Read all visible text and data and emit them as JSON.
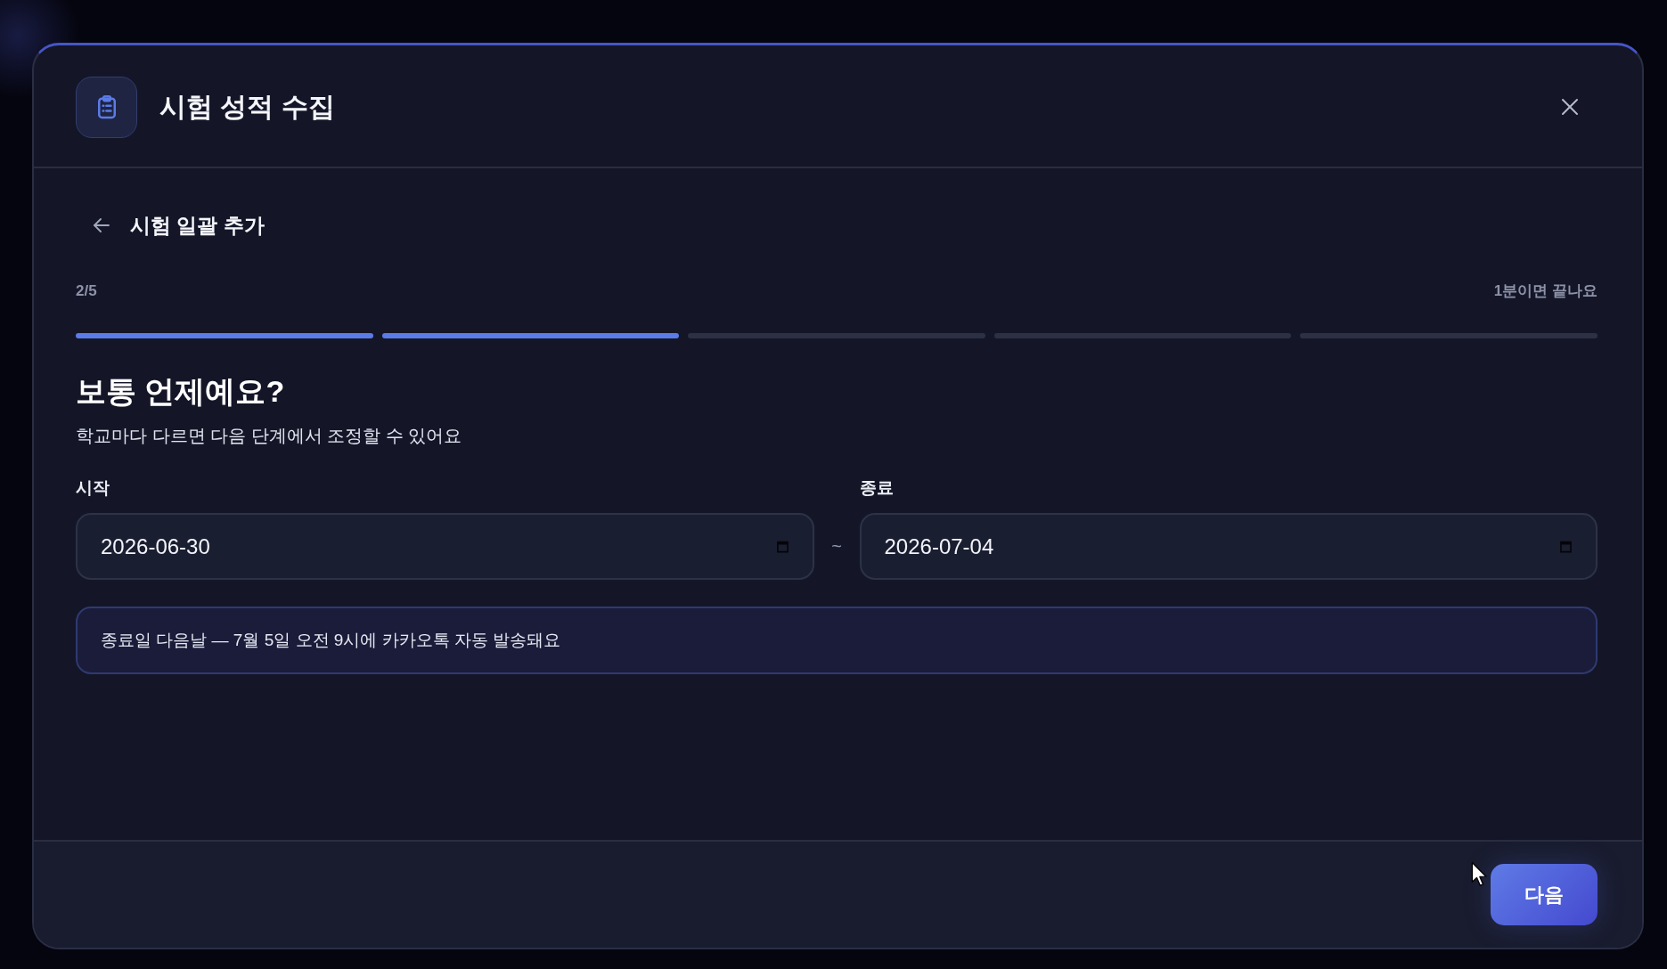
{
  "dialog": {
    "title": "시험 성적 수집"
  },
  "step_header": {
    "title": "시험 일괄 추가"
  },
  "progress": {
    "step": "2/5",
    "hint": "1분이면 끝나요",
    "segments": [
      {
        "filled": true
      },
      {
        "filled": true
      },
      {
        "filled": false
      },
      {
        "filled": false
      },
      {
        "filled": false
      }
    ]
  },
  "question": {
    "heading": "보통 언제예요?",
    "description": "학교마다 다르면 다음 단계에서 조정할 수 있어요"
  },
  "date_range": {
    "start": {
      "label": "시작",
      "value": "2026-06-30"
    },
    "separator": "~",
    "end": {
      "label": "종료",
      "value": "2026-07-04"
    }
  },
  "notice": "종료일 다음날 — 7월 5일 오전 9시에 카카오톡 자동 발송돼요",
  "footer": {
    "next_button": "다음"
  }
}
